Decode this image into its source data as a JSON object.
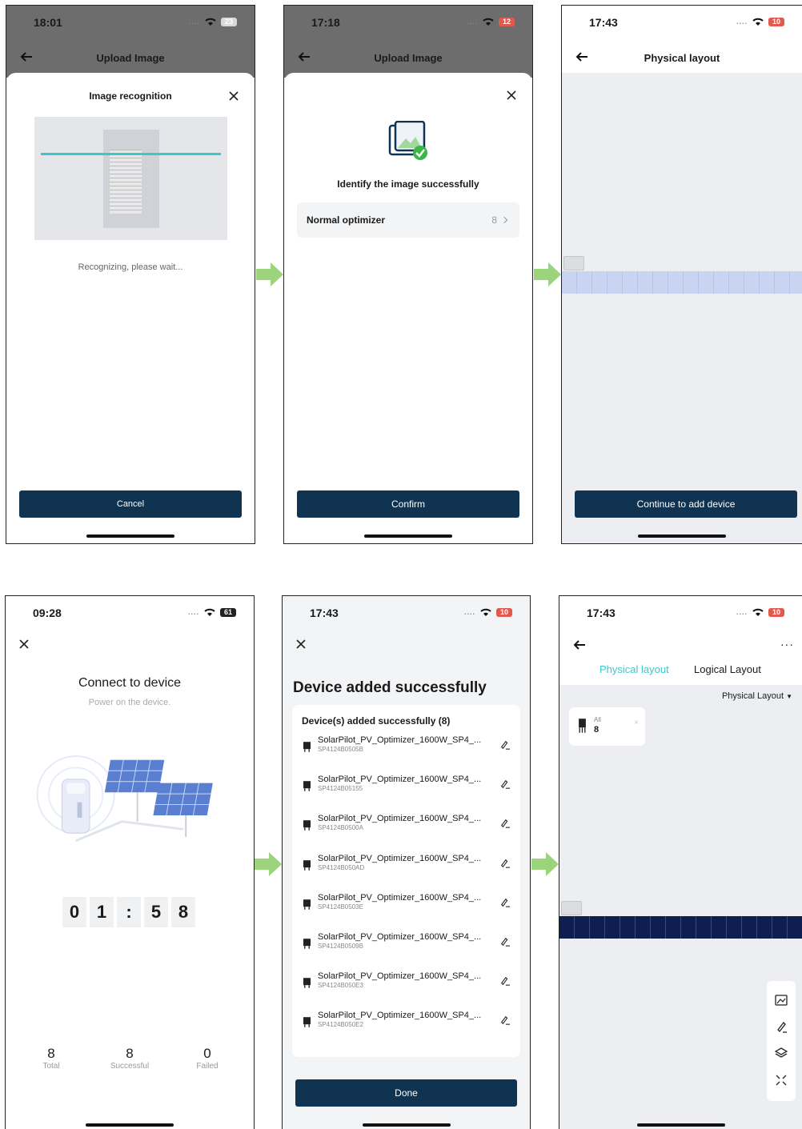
{
  "screens": {
    "s1": {
      "time": "18:01",
      "battery": "23",
      "header_title": "Upload Image",
      "dialog_title": "Image recognition",
      "status_text": "Recognizing, please wait...",
      "cancel_label": "Cancel"
    },
    "s2": {
      "time": "17:18",
      "battery": "12",
      "header_title": "Upload Image",
      "success_text": "Identify the image successfully",
      "result_label": "Normal optimizer",
      "result_count": "8",
      "confirm_label": "Confirm"
    },
    "s3": {
      "time": "17:43",
      "battery": "10",
      "header_title": "Physical layout",
      "continue_label": "Continue to add device"
    },
    "s4": {
      "time": "09:28",
      "battery": "61",
      "title": "Connect to device",
      "subtitle": "Power on the device.",
      "countdown": [
        "0",
        "1",
        ":",
        "5",
        "8"
      ],
      "stats": [
        {
          "value": "8",
          "label": "Total"
        },
        {
          "value": "8",
          "label": "Successful"
        },
        {
          "value": "0",
          "label": "Failed"
        }
      ]
    },
    "s5": {
      "time": "17:43",
      "battery": "10",
      "title": "Device added successfully",
      "list_header": "Device(s) added successfully (8)",
      "devices": [
        {
          "name": "SolarPilot_PV_Optimizer_1600W_SP4_...",
          "sn": "SP4124B0505B"
        },
        {
          "name": "SolarPilot_PV_Optimizer_1600W_SP4_...",
          "sn": "SP4124B05155"
        },
        {
          "name": "SolarPilot_PV_Optimizer_1600W_SP4_...",
          "sn": "SP4124B0500A"
        },
        {
          "name": "SolarPilot_PV_Optimizer_1600W_SP4_...",
          "sn": "SP4124B050AD"
        },
        {
          "name": "SolarPilot_PV_Optimizer_1600W_SP4_...",
          "sn": "SP4124B0503E"
        },
        {
          "name": "SolarPilot_PV_Optimizer_1600W_SP4_...",
          "sn": "SP4124B0509B"
        },
        {
          "name": "SolarPilot_PV_Optimizer_1600W_SP4_...",
          "sn": "SP4124B050E3"
        },
        {
          "name": "SolarPilot_PV_Optimizer_1600W_SP4_...",
          "sn": "SP4124B050E2"
        }
      ],
      "done_label": "Done"
    },
    "s6": {
      "time": "17:43",
      "battery": "10",
      "tab_physical": "Physical layout",
      "tab_logical": "Logical Layout",
      "layout_select": "Physical Layout",
      "all_label": "All",
      "all_count": "8"
    }
  },
  "colors": {
    "primary": "#0f3350",
    "accent_teal": "#3fc6c9",
    "arrow_green": "#9bd47a",
    "success_green": "#3ab54a",
    "panel_navy": "#0e1f4f"
  }
}
